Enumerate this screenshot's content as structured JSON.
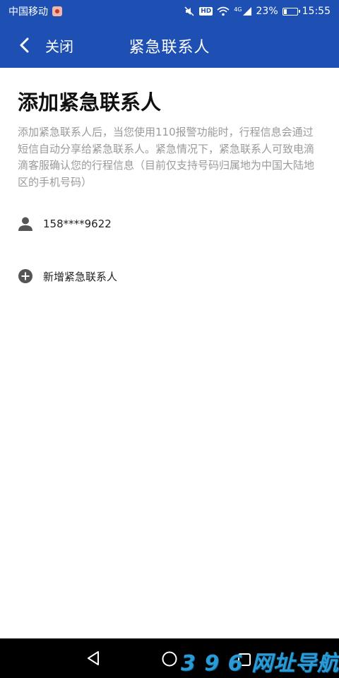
{
  "status_bar": {
    "carrier": "中国移动",
    "hd": "HD",
    "network": "4G",
    "battery": "23%",
    "battery_level": 0.23,
    "time": "15:55"
  },
  "header": {
    "close_label": "关闭",
    "title": "紧急联系人"
  },
  "main": {
    "page_title": "添加紧急联系人",
    "description": "添加紧急联系人后，当您使用110报警功能时，行程信息会通过短信自动分享给紧急联系人。紧急情况下，紧急联系人可致电滴滴客服确认您的行程信息（目前仅支持号码归属地为中国大陆地区的手机号码）",
    "contacts": [
      {
        "phone": "158****9622"
      }
    ],
    "add_contact_label": "新增紧急联系人"
  },
  "watermark": "3 9 6 网址导航",
  "colors": {
    "primary": "#1e50b4",
    "title_text": "#111111",
    "description_text": "#9a9a9a",
    "icon_gray": "#555555"
  }
}
